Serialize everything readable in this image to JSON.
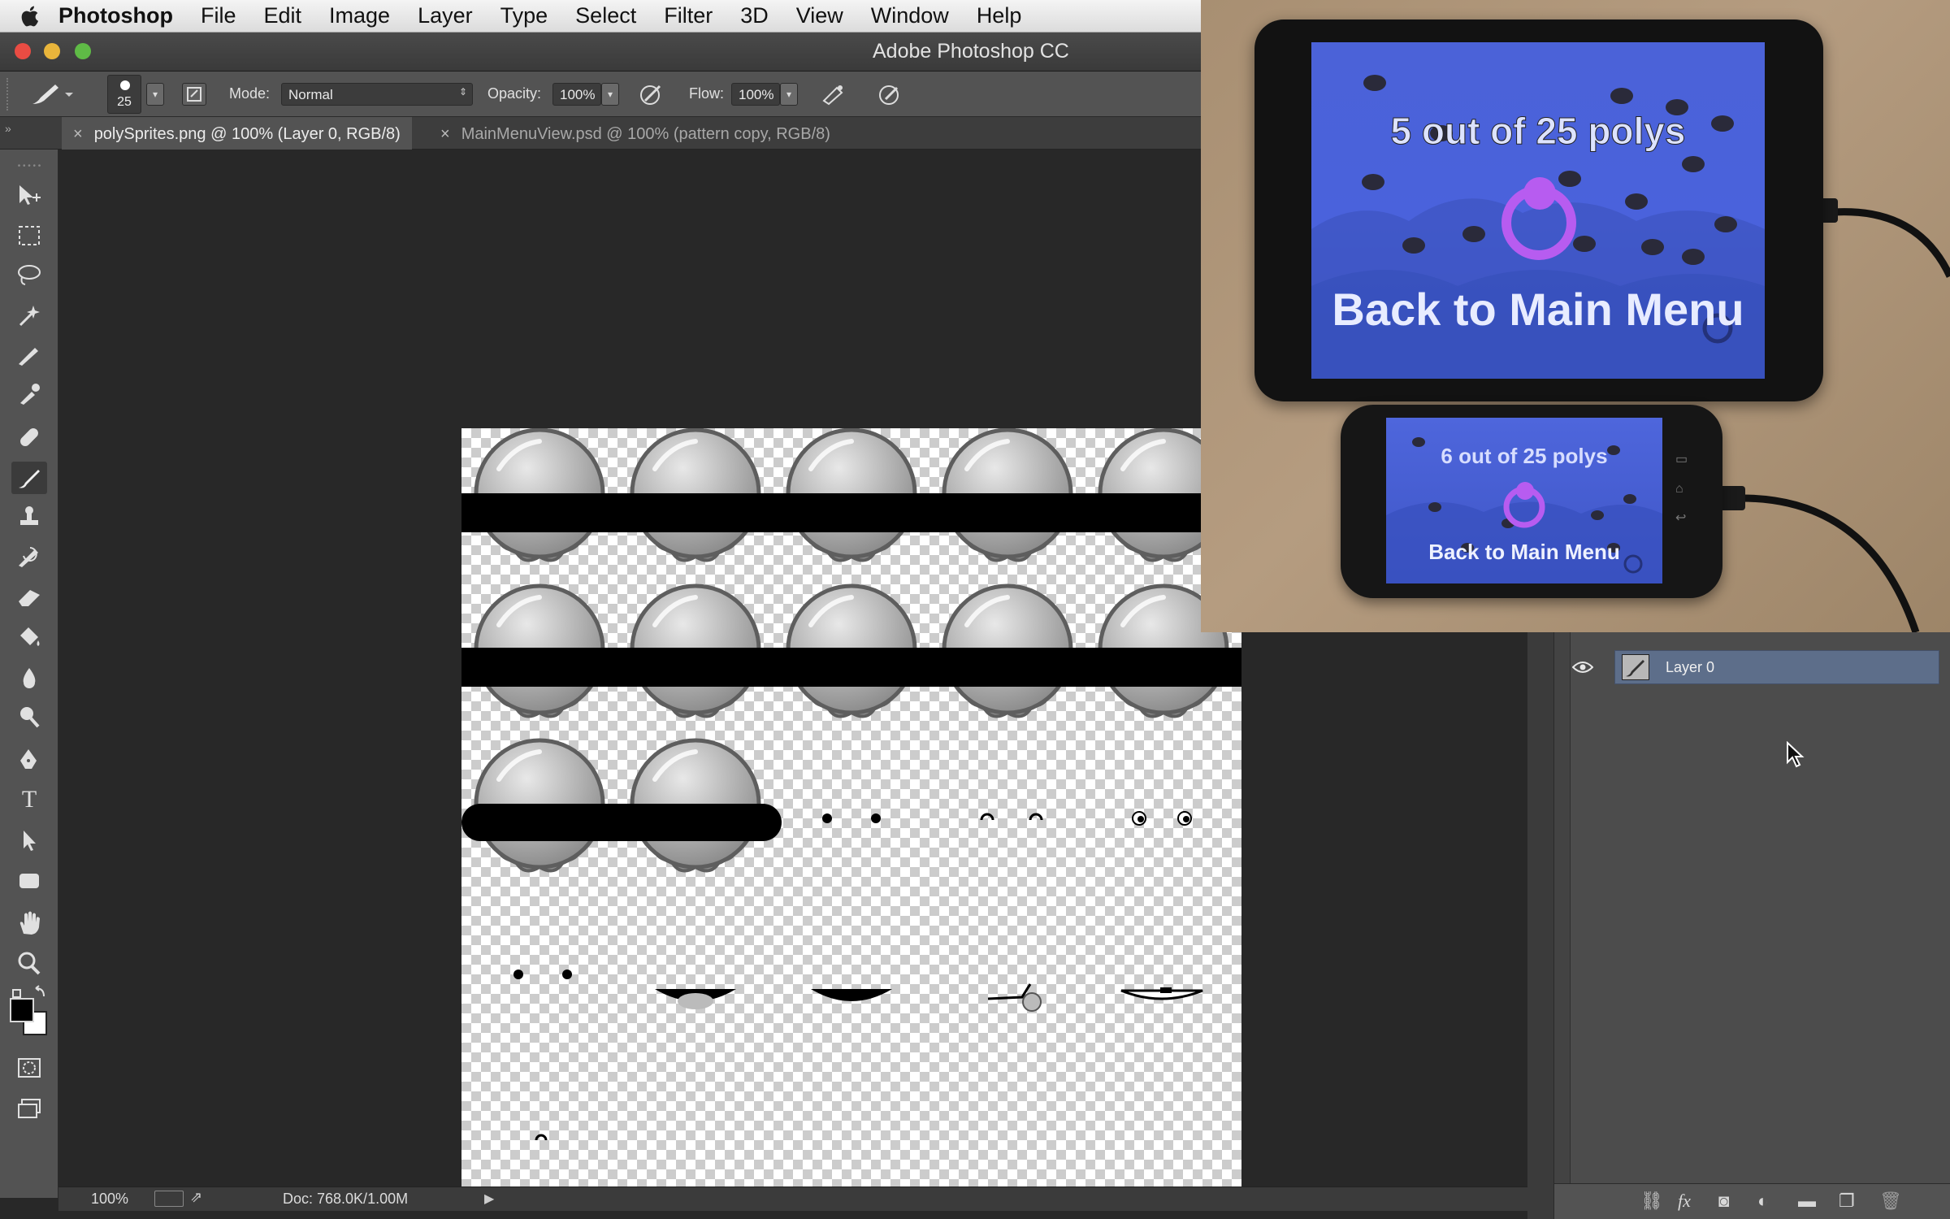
{
  "menubar": {
    "app": "Photoshop",
    "items": [
      "File",
      "Edit",
      "Image",
      "Layer",
      "Type",
      "Select",
      "Filter",
      "3D",
      "View",
      "Window",
      "Help"
    ]
  },
  "window": {
    "title": "Adobe Photoshop CC"
  },
  "options": {
    "brush_size": "25",
    "mode_label": "Mode:",
    "mode_value": "Normal",
    "opacity_label": "Opacity:",
    "opacity_value": "100%",
    "flow_label": "Flow:",
    "flow_value": "100%"
  },
  "tabs": [
    {
      "label": "polySprites.png @ 100% (Layer 0, RGB/8)",
      "active": true
    },
    {
      "label": "MainMenuView.psd @ 100% (pattern copy, RGB/8)",
      "active": false
    }
  ],
  "tools": [
    "move-tool",
    "marquee-tool",
    "lasso-tool",
    "magic-wand-tool",
    "crop-tool",
    "eyedropper-tool",
    "healing-brush-tool",
    "brush-tool",
    "clone-stamp-tool",
    "history-brush-tool",
    "eraser-tool",
    "paint-bucket-tool",
    "blur-tool",
    "dodge-tool",
    "pen-tool",
    "type-tool",
    "path-selection-tool",
    "shape-tool",
    "hand-tool",
    "zoom-tool"
  ],
  "colors": {
    "foreground": "#000000",
    "background": "#ffffff",
    "layer_selected": "#5d6e8a"
  },
  "status": {
    "zoom": "100%",
    "doc": "Doc: 768.0K/1.00M"
  },
  "layers": [
    {
      "name": "Layer 0",
      "visible": true,
      "selected": true
    }
  ],
  "camera": {
    "tablet": {
      "line1": "5 out of 25 polys",
      "line2": "Back to Main Menu"
    },
    "phone": {
      "line1": "6 out of 25 polys",
      "line2": "Back to Main Menu"
    }
  }
}
